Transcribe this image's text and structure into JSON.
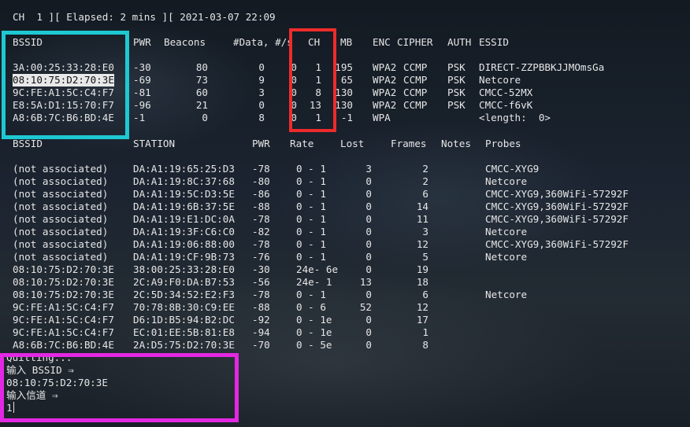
{
  "status_line": "CH  1 ][ Elapsed: 2 mins ][ 2021-03-07 22:09",
  "ap_table": {
    "headers": [
      "BSSID",
      "PWR",
      "Beacons",
      "#Data, #/s",
      "CH",
      "MB",
      "ENC",
      "CIPHER",
      "AUTH",
      "ESSID"
    ],
    "rows": [
      {
        "bssid": "3A:00:25:33:28:E0",
        "pwr": "-30",
        "beacons": "80",
        "data": "0",
        "s": "0",
        "ch": "1",
        "mb": "195",
        "enc": "WPA2",
        "cipher": "CCMP",
        "auth": "PSK",
        "essid": "DIRECT-ZZPBBKJJMOmsGa"
      },
      {
        "bssid": "08:10:75:D2:70:3E",
        "pwr": "-69",
        "beacons": "73",
        "data": "9",
        "s": "0",
        "ch": "1",
        "mb": "65",
        "enc": "WPA2",
        "cipher": "CCMP",
        "auth": "PSK",
        "essid": "Netcore"
      },
      {
        "bssid": "9C:FE:A1:5C:C4:F7",
        "pwr": "-81",
        "beacons": "60",
        "data": "3",
        "s": "0",
        "ch": "8",
        "mb": "130",
        "enc": "WPA2",
        "cipher": "CCMP",
        "auth": "PSK",
        "essid": "CMCC-52MX"
      },
      {
        "bssid": "E8:5A:D1:15:70:F7",
        "pwr": "-96",
        "beacons": "21",
        "data": "0",
        "s": "0",
        "ch": "13",
        "mb": "130",
        "enc": "WPA2",
        "cipher": "CCMP",
        "auth": "PSK",
        "essid": "CMCC-f6vK"
      },
      {
        "bssid": "A8:6B:7C:B6:BD:4E",
        "pwr": "-1",
        "beacons": "0",
        "data": "8",
        "s": "0",
        "ch": "1",
        "mb": "-1",
        "enc": "WPA",
        "cipher": "",
        "auth": "",
        "essid": "<length:  0>"
      }
    ]
  },
  "station_table": {
    "headers": [
      "BSSID",
      "STATION",
      "PWR",
      "Rate",
      "Lost",
      "Frames",
      "Notes",
      "Probes"
    ],
    "rows": [
      {
        "bssid": "(not associated)",
        "station": "DA:A1:19:65:25:D3",
        "pwr": "-78",
        "rate": "0 - 1",
        "lost": "3",
        "frames": "2",
        "notes": "",
        "probes": "CMCC-XYG9"
      },
      {
        "bssid": "(not associated)",
        "station": "DA:A1:19:8C:37:68",
        "pwr": "-80",
        "rate": "0 - 1",
        "lost": "0",
        "frames": "2",
        "notes": "",
        "probes": "Netcore"
      },
      {
        "bssid": "(not associated)",
        "station": "DA:A1:19:5C:D3:5E",
        "pwr": "-86",
        "rate": "0 - 1",
        "lost": "0",
        "frames": "6",
        "notes": "",
        "probes": "CMCC-XYG9,360WiFi-57292F"
      },
      {
        "bssid": "(not associated)",
        "station": "DA:A1:19:6B:37:5E",
        "pwr": "-88",
        "rate": "0 - 1",
        "lost": "0",
        "frames": "14",
        "notes": "",
        "probes": "CMCC-XYG9,360WiFi-57292F"
      },
      {
        "bssid": "(not associated)",
        "station": "DA:A1:19:E1:DC:0A",
        "pwr": "-78",
        "rate": "0 - 1",
        "lost": "0",
        "frames": "11",
        "notes": "",
        "probes": "CMCC-XYG9,360WiFi-57292F"
      },
      {
        "bssid": "(not associated)",
        "station": "DA:A1:19:3F:C6:C0",
        "pwr": "-82",
        "rate": "0 - 1",
        "lost": "0",
        "frames": "3",
        "notes": "",
        "probes": "Netcore"
      },
      {
        "bssid": "(not associated)",
        "station": "DA:A1:19:06:88:00",
        "pwr": "-78",
        "rate": "0 - 1",
        "lost": "0",
        "frames": "12",
        "notes": "",
        "probes": "CMCC-XYG9,360WiFi-57292F"
      },
      {
        "bssid": "(not associated)",
        "station": "DA:A1:19:CF:9B:73",
        "pwr": "-76",
        "rate": "0 - 1",
        "lost": "0",
        "frames": "5",
        "notes": "",
        "probes": "Netcore"
      },
      {
        "bssid": "08:10:75:D2:70:3E",
        "station": "38:00:25:33:28:E0",
        "pwr": "-30",
        "rate": "24e- 6e",
        "lost": "0",
        "frames": "19",
        "notes": "",
        "probes": ""
      },
      {
        "bssid": "08:10:75:D2:70:3E",
        "station": "2C:A9:F0:DA:B7:53",
        "pwr": "-56",
        "rate": "24e- 1",
        "lost": "13",
        "frames": "18",
        "notes": "",
        "probes": ""
      },
      {
        "bssid": "08:10:75:D2:70:3E",
        "station": "2C:5D:34:52:E2:F3",
        "pwr": "-78",
        "rate": "0 - 1",
        "lost": "0",
        "frames": "6",
        "notes": "",
        "probes": "Netcore"
      },
      {
        "bssid": "9C:FE:A1:5C:C4:F7",
        "station": "70:78:8B:30:C9:EE",
        "pwr": "-88",
        "rate": "0 - 6",
        "lost": "52",
        "frames": "12",
        "notes": "",
        "probes": ""
      },
      {
        "bssid": "9C:FE:A1:5C:C4:F7",
        "station": "D6:1D:B5:94:B2:DC",
        "pwr": "-92",
        "rate": "0 - 1e",
        "lost": "0",
        "frames": "17",
        "notes": "",
        "probes": ""
      },
      {
        "bssid": "9C:FE:A1:5C:C4:F7",
        "station": "EC:01:EE:5B:81:E8",
        "pwr": "-94",
        "rate": "0 - 1e",
        "lost": "0",
        "frames": "1",
        "notes": "",
        "probes": ""
      },
      {
        "bssid": "A8:6B:7C:B6:BD:4E",
        "station": "2A:D5:75:D2:70:3E",
        "pwr": "-70",
        "rate": "0 - 5e",
        "lost": "0",
        "frames": "8",
        "notes": "",
        "probes": ""
      }
    ]
  },
  "prompt": {
    "quitting": "Quitting...",
    "bssid_prompt": "输入 BSSID ⇒",
    "bssid_value": "08:10:75:D2:70:3E",
    "channel_prompt": "输入信道 ⇒",
    "channel_value": "1"
  },
  "highlight_colors": {
    "bssid_box": "#1ec8d2",
    "channel_box": "#ee2b2b",
    "prompt_box": "#e328e3"
  }
}
